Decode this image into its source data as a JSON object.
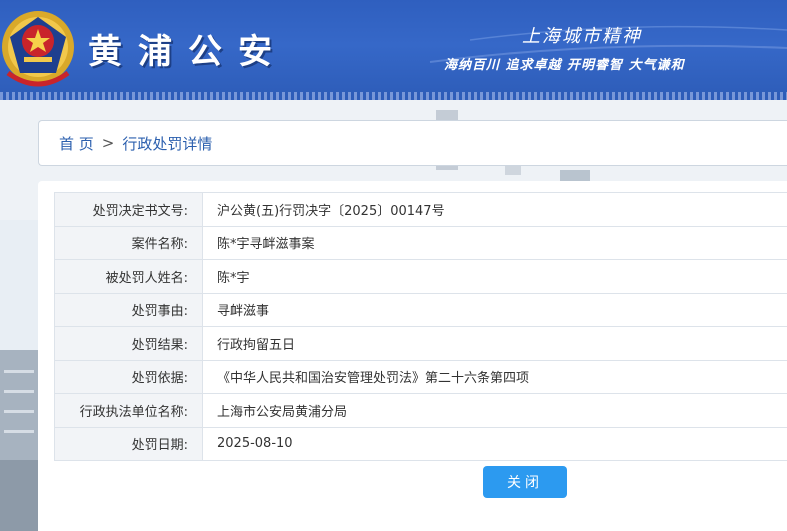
{
  "header": {
    "site_title": "黄浦公安",
    "slogan_main": "上海城市精神",
    "slogan_sub": "海纳百川 追求卓越 开明睿智 大气谦和"
  },
  "breadcrumb": {
    "home": "首 页",
    "separator": ">",
    "current": "行政处罚详情"
  },
  "details": [
    {
      "label": "处罚决定书文号:",
      "value": "沪公黄(五)行罚决字〔2025〕00147号"
    },
    {
      "label": "案件名称:",
      "value": "陈*宇寻衅滋事案"
    },
    {
      "label": "被处罚人姓名:",
      "value": "陈*宇"
    },
    {
      "label": "处罚事由:",
      "value": "寻衅滋事"
    },
    {
      "label": "处罚结果:",
      "value": "行政拘留五日"
    },
    {
      "label": "处罚依据:",
      "value": "《中华人民共和国治安管理处罚法》第二十六条第四项"
    },
    {
      "label": "行政执法单位名称:",
      "value": "上海市公安局黄浦分局"
    },
    {
      "label": "处罚日期:",
      "value": "2025-08-10"
    }
  ],
  "actions": {
    "close_label": "关闭"
  },
  "colors": {
    "header_blue": "#3668c8",
    "link_blue": "#2b5fae",
    "button_blue": "#2c9af0"
  }
}
